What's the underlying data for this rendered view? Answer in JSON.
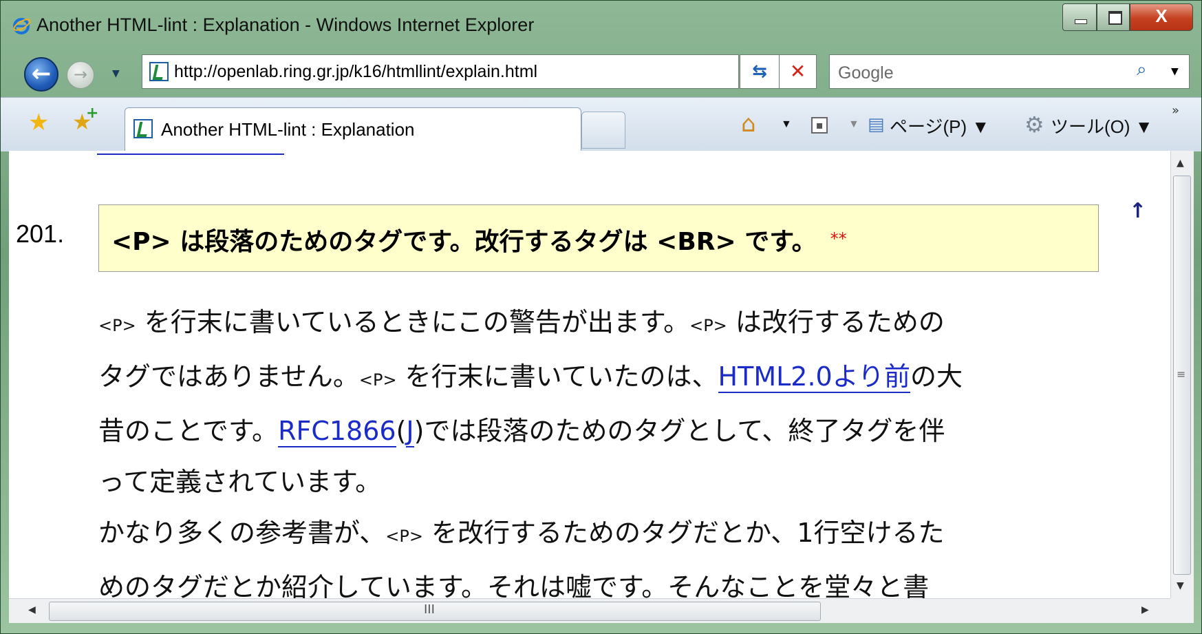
{
  "window": {
    "title": "Another HTML-lint : Explanation - Windows Internet Explorer",
    "close_glyph": "X"
  },
  "nav": {
    "back_glyph": "←",
    "forward_glyph": "→",
    "dropdown_glyph": "▼",
    "address": "http://openlab.ring.gr.jp/k16/htmllint/explain.html",
    "refresh_glyph": "⇆",
    "stop_glyph": "✕",
    "search_placeholder": "Google",
    "search_glyph": "⌕"
  },
  "tabbar": {
    "tab_label": "Another HTML-lint : Explanation",
    "page_menu": "ページ(P) ▼",
    "tools_menu": "ツール(O) ▼",
    "more_glyph": "»",
    "home_drop": "▼",
    "rss_drop": "▼"
  },
  "content": {
    "item_number": "201.",
    "heading": "<P> は段落のためのタグです。改行するタグは <BR> です。",
    "severity": "**",
    "top_link_glyph": "↑",
    "p_tag": "<P>",
    "lines": {
      "l1_a": " を行末に書いているときにこの警告が出ます。",
      "l1_b": " は改行するための",
      "l2_a": "タグではありません。",
      "l2_b": " を行末に書いていたのは、",
      "l2_link": "HTML2.0より前",
      "l2_c": "の大",
      "l3_a": "昔のことです。",
      "l3_link1": "RFC1866",
      "l3_paren_open": "(",
      "l3_link2": "J",
      "l3_b": ")では段落のためのタグとして、終了タグを伴",
      "l4": "って定義されています。",
      "l5_a": "かなり多くの参考書が、",
      "l5_b": " を改行するためのタグだとか、1行空けるた",
      "l6": "めのタグだとか紹介しています。それは嘘です。そんなことを堂々と書"
    }
  },
  "scroll": {
    "up": "▲",
    "down": "▼",
    "left": "◀",
    "right": "▶",
    "hgrip": "III",
    "vgrip": "≡"
  },
  "colors": {
    "heading_bg": "#ffffcc",
    "link": "#1b2bc8",
    "severity": "#e01010"
  }
}
